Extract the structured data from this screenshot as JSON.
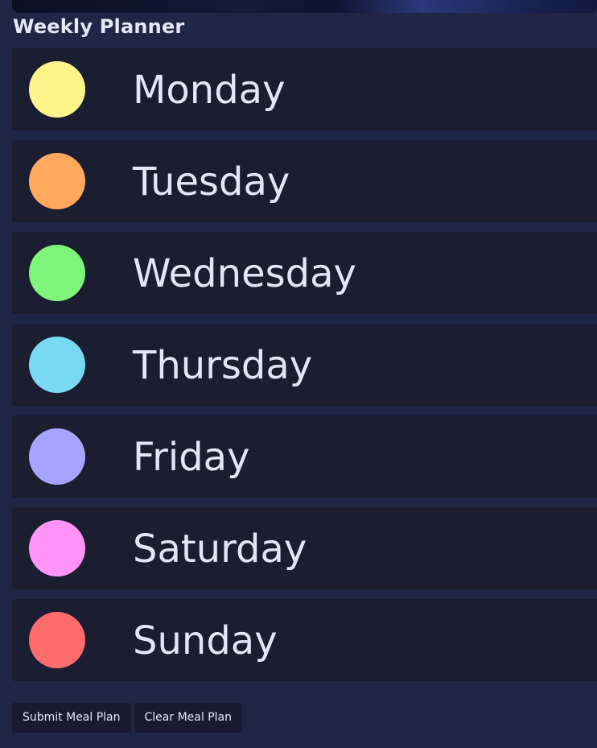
{
  "planner": {
    "title": "Weekly Planner",
    "days": [
      {
        "label": "Monday",
        "color": "#fff48a"
      },
      {
        "label": "Tuesday",
        "color": "#ffa95e"
      },
      {
        "label": "Wednesday",
        "color": "#7ff47b"
      },
      {
        "label": "Thursday",
        "color": "#79d8f2"
      },
      {
        "label": "Friday",
        "color": "#a7a4ff"
      },
      {
        "label": "Saturday",
        "color": "#ff94f7"
      },
      {
        "label": "Sunday",
        "color": "#ff6c6c"
      }
    ]
  },
  "actions": {
    "submit_label": "Submit Meal Plan",
    "clear_label": "Clear Meal Plan"
  }
}
